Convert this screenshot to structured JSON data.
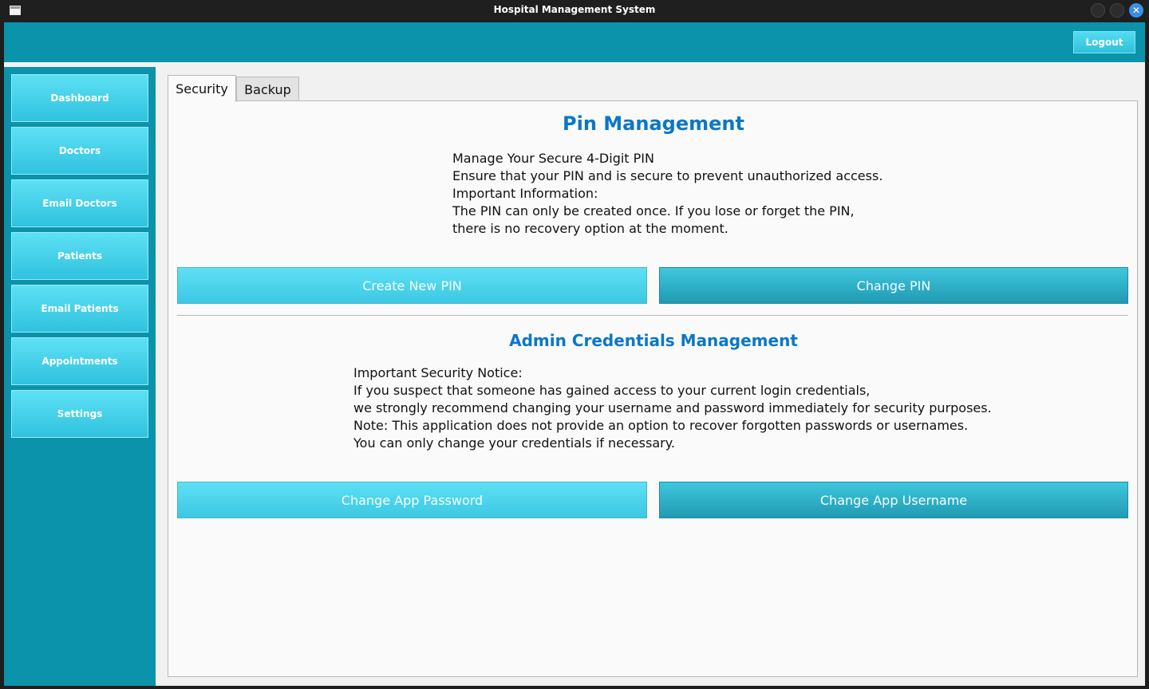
{
  "window": {
    "title": "Hospital Management System",
    "close_glyph": "✕"
  },
  "header": {
    "logout_label": "Logout"
  },
  "sidebar": {
    "items": [
      {
        "label": "Dashboard"
      },
      {
        "label": "Doctors"
      },
      {
        "label": "Email Doctors"
      },
      {
        "label": "Patients"
      },
      {
        "label": "Email Patients"
      },
      {
        "label": "Appointments"
      },
      {
        "label": "Settings"
      }
    ]
  },
  "tabs": [
    {
      "label": "Security",
      "active": true
    },
    {
      "label": "Backup",
      "active": false
    }
  ],
  "security": {
    "pin": {
      "title": "Pin Management",
      "lines": [
        "Manage Your Secure 4-Digit PIN",
        "Ensure that your PIN and is secure to prevent unauthorized access.",
        "Important Information:",
        "The PIN can only be created once. If you lose or forget the PIN,",
        "there is no recovery option at the moment."
      ],
      "create_label": "Create New PIN",
      "change_label": "Change PIN"
    },
    "admin": {
      "title": "Admin Credentials Management",
      "lines": [
        "Important Security Notice:",
        "If you suspect that someone has gained access to your current login credentials,",
        "we strongly recommend changing your username and password immediately for security purposes.",
        "Note: This application does not provide an option to recover forgotten passwords or usernames.",
        "You can only change your credentials if necessary."
      ],
      "change_password_label": "Change App Password",
      "change_username_label": "Change App Username"
    }
  },
  "colors": {
    "header": "#0b93ab",
    "button_light": "#5ee0f5",
    "button_dark": "#219ab2",
    "heading": "#0a77c7"
  }
}
